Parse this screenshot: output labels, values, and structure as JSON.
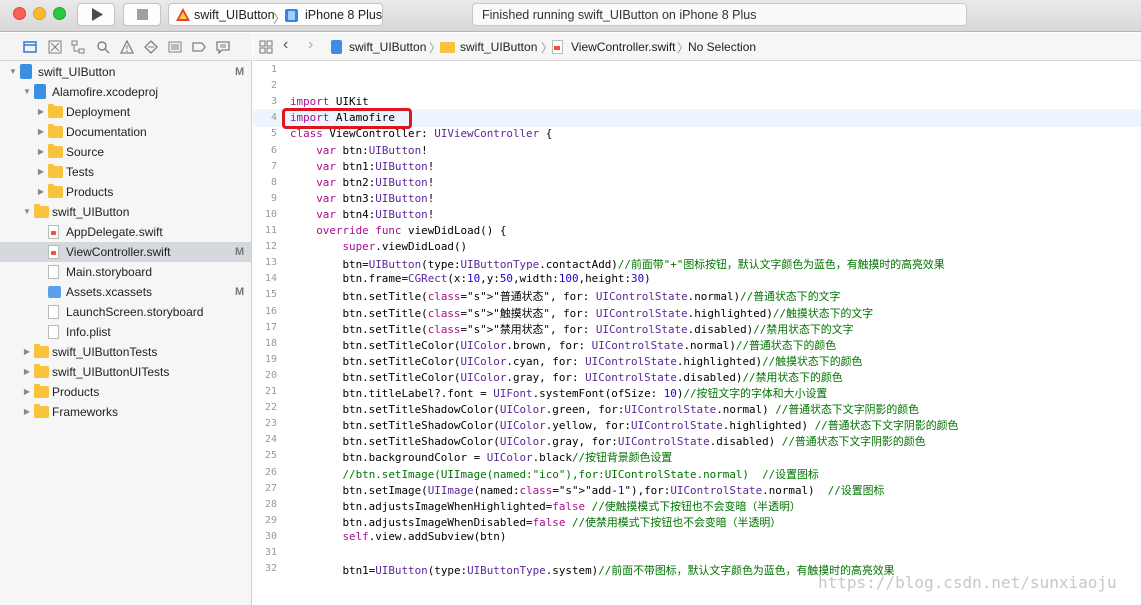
{
  "toolbar": {
    "run_icon": "play-icon",
    "stop_icon": "stop-icon",
    "scheme_name": "swift_UIButton",
    "device_name": "iPhone 8 Plus",
    "status_text": "Finished running swift_UIButton on iPhone 8 Plus"
  },
  "navigator_icons": [
    "folder-icon",
    "source-control-icon",
    "hierarchy-icon",
    "search-icon",
    "warning-icon",
    "test-icon",
    "debug-icon",
    "breakpoint-icon",
    "report-icon"
  ],
  "sidebar": {
    "items": [
      {
        "label": "swift_UIButton",
        "badge": "M",
        "icon": "project"
      },
      {
        "label": "Alamofire.xcodeproj",
        "badge": "",
        "icon": "project"
      },
      {
        "label": "Deployment",
        "badge": "",
        "icon": "folder"
      },
      {
        "label": "Documentation",
        "badge": "",
        "icon": "folder"
      },
      {
        "label": "Source",
        "badge": "",
        "icon": "folder"
      },
      {
        "label": "Tests",
        "badge": "",
        "icon": "folder"
      },
      {
        "label": "Products",
        "badge": "",
        "icon": "folder"
      },
      {
        "label": "swift_UIButton",
        "badge": "",
        "icon": "folder"
      },
      {
        "label": "AppDelegate.swift",
        "badge": "",
        "icon": "swift"
      },
      {
        "label": "ViewController.swift",
        "badge": "M",
        "icon": "swift"
      },
      {
        "label": "Main.storyboard",
        "badge": "",
        "icon": "doc"
      },
      {
        "label": "Assets.xcassets",
        "badge": "M",
        "icon": "assets"
      },
      {
        "label": "LaunchScreen.storyboard",
        "badge": "",
        "icon": "doc"
      },
      {
        "label": "Info.plist",
        "badge": "",
        "icon": "doc"
      },
      {
        "label": "swift_UIButtonTests",
        "badge": "",
        "icon": "folder"
      },
      {
        "label": "swift_UIButtonUITests",
        "badge": "",
        "icon": "folder"
      },
      {
        "label": "Products",
        "badge": "",
        "icon": "folder"
      },
      {
        "label": "Frameworks",
        "badge": "",
        "icon": "folder"
      }
    ]
  },
  "jumpbar": {
    "project": "swift_UIButton",
    "group": "swift_UIButton",
    "file": "ViewController.swift",
    "selection": "No Selection"
  },
  "editor": {
    "line_numbers": [
      "1",
      "2",
      "3",
      "4",
      "5",
      "6",
      "7",
      "8",
      "9",
      "10",
      "11",
      "12",
      "13",
      "14",
      "15",
      "16",
      "17",
      "18",
      "19",
      "20",
      "21",
      "22",
      "23",
      "24",
      "25",
      "26",
      "27",
      "28",
      "29",
      "30",
      "31",
      "32"
    ],
    "lines": [
      "",
      "",
      "import UIKit",
      "import Alamofire",
      "class ViewController: UIViewController {",
      "    var btn:UIButton!",
      "    var btn1:UIButton!",
      "    var btn2:UIButton!",
      "    var btn3:UIButton!",
      "    var btn4:UIButton!",
      "    override func viewDidLoad() {",
      "        super.viewDidLoad()",
      "        btn=UIButton(type:UIButtonType.contactAdd)//前面带\"+\"图标按钮，默认文字颜色为蓝色，有触摸时的高亮效果",
      "        btn.frame=CGRect(x:10,y:50,width:100,height:30)",
      "        btn.setTitle(\"普通状态\", for: UIControlState.normal)//普通状态下的文字",
      "        btn.setTitle(\"触摸状态\", for: UIControlState.highlighted)//触摸状态下的文字",
      "        btn.setTitle(\"禁用状态\", for: UIControlState.disabled)//禁用状态下的文字",
      "        btn.setTitleColor(UIColor.brown, for: UIControlState.normal)//普通状态下的颜色",
      "        btn.setTitleColor(UIColor.cyan, for: UIControlState.highlighted)//触摸状态下的颜色",
      "        btn.setTitleColor(UIColor.gray, for: UIControlState.disabled)//禁用状态下的颜色",
      "        btn.titleLabel?.font = UIFont.systemFont(ofSize: 10)//按钮文字的字体和大小设置",
      "        btn.setTitleShadowColor(UIColor.green, for:UIControlState.normal) //普通状态下文字阴影的颜色",
      "        btn.setTitleShadowColor(UIColor.yellow, for:UIControlState.highlighted) //普通状态下文字阴影的颜色",
      "        btn.setTitleShadowColor(UIColor.gray, for:UIControlState.disabled) //普通状态下文字阴影的颜色",
      "        btn.backgroundColor = UIColor.black//按钮背景颜色设置",
      "        //btn.setImage(UIImage(named:\"ico\"),for:UIControlState.normal)  //设置图标",
      "        btn.setImage(UIImage(named:\"add-1\"),for:UIControlState.normal)  //设置图标",
      "        btn.adjustsImageWhenHighlighted=false //使触摸模式下按钮也不会变暗（半透明）",
      "        btn.adjustsImageWhenDisabled=false //使禁用模式下按钮也不会变暗（半透明）",
      "        self.view.addSubview(btn)",
      "",
      "        btn1=UIButton(type:UIButtonType.system)//前面不带图标，默认文字颜色为蓝色，有触摸时的高亮效果"
    ],
    "current_line": "4"
  },
  "watermark": "https://blog.csdn.net/sunxiaoju"
}
